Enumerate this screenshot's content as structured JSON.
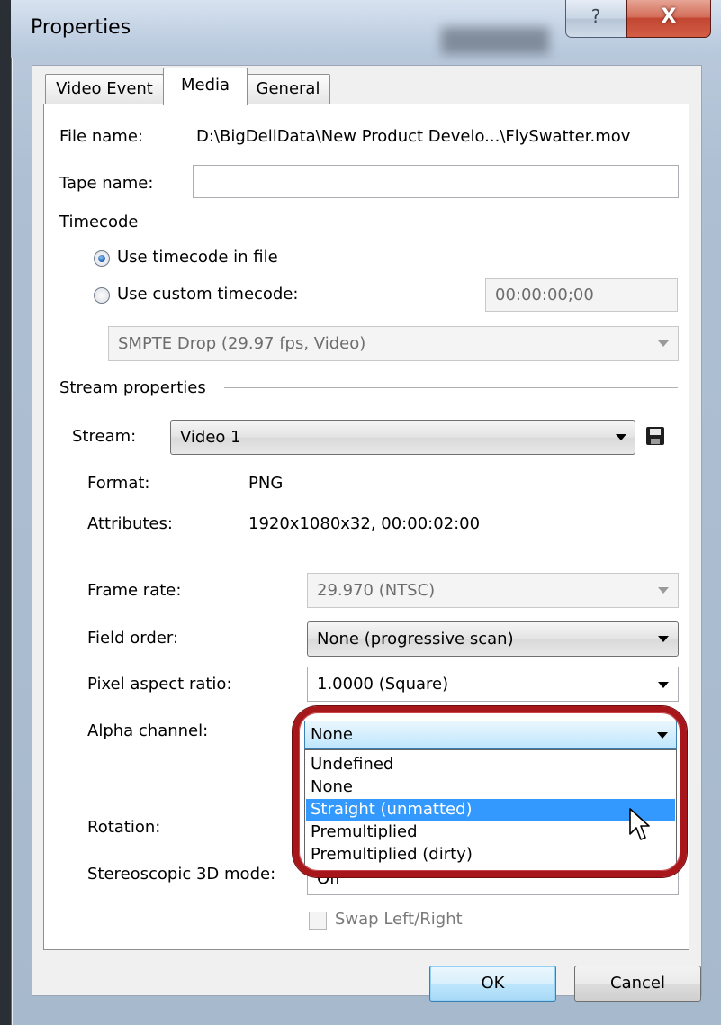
{
  "window": {
    "title": "Properties",
    "help_glyph": "?",
    "close_glyph": "X"
  },
  "tabs": [
    {
      "label": "Video Event"
    },
    {
      "label": "Media"
    },
    {
      "label": "General"
    }
  ],
  "file": {
    "label": "File name:",
    "value": "D:\\BigDellData\\New Product Develo...\\FlySwatter.mov"
  },
  "tape": {
    "label": "Tape name:",
    "value": ""
  },
  "timecode": {
    "section": "Timecode",
    "use_file_label": "Use timecode in file",
    "use_custom_label": "Use custom timecode:",
    "custom_value": "00:00:00;00",
    "format_value": "SMPTE Drop (29.97 fps, Video)"
  },
  "stream": {
    "section": "Stream properties",
    "label": "Stream:",
    "value": "Video 1",
    "format_label": "Format:",
    "format_value": "PNG",
    "attributes_label": "Attributes:",
    "attributes_value": "1920x1080x32, 00:00:02:00"
  },
  "frame_rate": {
    "label": "Frame rate:",
    "value": "29.970 (NTSC)"
  },
  "field_order": {
    "label": "Field order:",
    "value": "None (progressive scan)"
  },
  "pixel_aspect": {
    "label": "Pixel aspect ratio:",
    "value": "1.0000 (Square)"
  },
  "alpha": {
    "label": "Alpha channel:",
    "value": "None",
    "options": [
      "Undefined",
      "None",
      "Straight (unmatted)",
      "Premultiplied",
      "Premultiplied (dirty)"
    ],
    "highlighted": "Straight (unmatted)"
  },
  "rotation": {
    "label": "Rotation:"
  },
  "stereo": {
    "label": "Stereoscopic 3D mode:",
    "value": "Off"
  },
  "swap": {
    "label": "Swap Left/Right",
    "checked": false
  },
  "buttons": {
    "ok": "OK",
    "cancel": "Cancel"
  },
  "icons": {
    "save": "floppy-disk-icon",
    "cursor": "mouse-pointer-icon"
  },
  "colors": {
    "highlight": "#3399ff",
    "callout_ring": "#a6161a",
    "close_button": "#c24632"
  }
}
